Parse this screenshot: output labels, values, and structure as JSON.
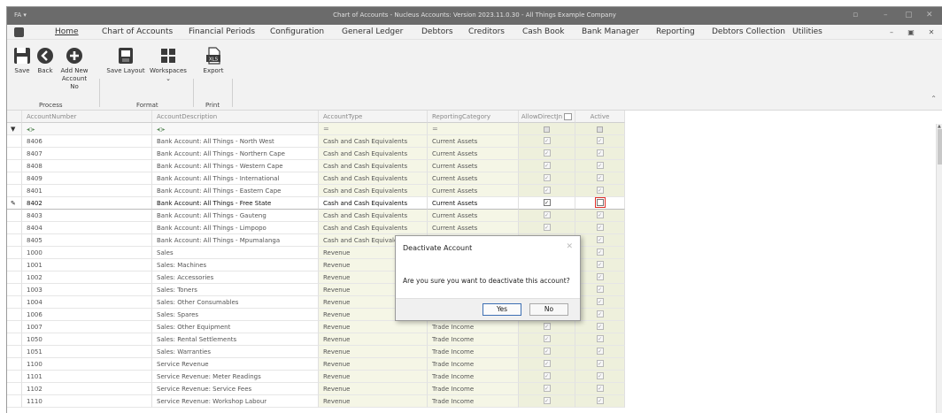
{
  "window": {
    "app_icon": "FA",
    "title": "Chart of Accounts - Nucleus Accounts: Version 2023.11.0.30 - All Things Example Company"
  },
  "menu": {
    "tabs": [
      "Home",
      "Chart of Accounts",
      "Financial Periods",
      "Configuration",
      "General Ledger",
      "Debtors",
      "Creditors",
      "Cash Book",
      "Bank Manager",
      "Reporting",
      "Debtors Collection",
      "Utilities"
    ],
    "active": "Home"
  },
  "ribbon": {
    "save": "Save",
    "back": "Back",
    "add_new_1": "Add New",
    "add_new_2": "Account No",
    "save_layout": "Save Layout",
    "workspaces": "Workspaces",
    "export": "Export",
    "export_badge": "XLS",
    "group_process": "Process",
    "group_format": "Format",
    "group_print": "Print"
  },
  "grid": {
    "headers": {
      "account_number": "AccountNumber",
      "account_description": "AccountDescription",
      "account_type": "AccountType",
      "reporting_category": "ReportingCategory",
      "allow_direct": "AllowDirectJn",
      "active": "Active"
    },
    "filter_eq": "=",
    "rows": [
      {
        "num": "8406",
        "desc": "Bank Account: All Things - North West",
        "type": "Cash and Cash Equivalents",
        "cat": "Current Assets",
        "allow": true,
        "active": true
      },
      {
        "num": "8407",
        "desc": "Bank Account: All Things - Northern Cape",
        "type": "Cash and Cash Equivalents",
        "cat": "Current Assets",
        "allow": true,
        "active": true
      },
      {
        "num": "8408",
        "desc": "Bank Account: All Things - Western Cape",
        "type": "Cash and Cash Equivalents",
        "cat": "Current Assets",
        "allow": true,
        "active": true
      },
      {
        "num": "8409",
        "desc": "Bank Account: All Things - International",
        "type": "Cash and Cash Equivalents",
        "cat": "Current Assets",
        "allow": true,
        "active": true
      },
      {
        "num": "8401",
        "desc": "Bank Account: All Things - Eastern Cape",
        "type": "Cash and Cash Equivalents",
        "cat": "Current Assets",
        "allow": true,
        "active": true
      },
      {
        "num": "8402",
        "desc": "Bank Account: All Things - Free State",
        "type": "Cash and Cash Equivalents",
        "cat": "Current Assets",
        "allow": true,
        "active": false,
        "selected": true
      },
      {
        "num": "8403",
        "desc": "Bank Account: All Things - Gauteng",
        "type": "Cash and Cash Equivalents",
        "cat": "Current Assets",
        "allow": true,
        "active": true
      },
      {
        "num": "8404",
        "desc": "Bank Account: All Things - Limpopo",
        "type": "Cash and Cash Equivalents",
        "cat": "Current Assets",
        "allow": true,
        "active": true
      },
      {
        "num": "8405",
        "desc": "Bank Account: All Things - Mpumalanga",
        "type": "Cash and Cash Equivalents",
        "cat": "",
        "allow": true,
        "active": true
      },
      {
        "num": "1000",
        "desc": "Sales",
        "type": "Revenue",
        "cat": "",
        "allow": true,
        "active": true
      },
      {
        "num": "1001",
        "desc": "Sales: Machines",
        "type": "Revenue",
        "cat": "",
        "allow": true,
        "active": true
      },
      {
        "num": "1002",
        "desc": "Sales: Accessories",
        "type": "Revenue",
        "cat": "",
        "allow": true,
        "active": true
      },
      {
        "num": "1003",
        "desc": "Sales: Toners",
        "type": "Revenue",
        "cat": "",
        "allow": true,
        "active": true
      },
      {
        "num": "1004",
        "desc": "Sales: Other Consumables",
        "type": "Revenue",
        "cat": "",
        "allow": true,
        "active": true
      },
      {
        "num": "1006",
        "desc": "Sales: Spares",
        "type": "Revenue",
        "cat": "Trade Income",
        "allow": true,
        "active": true
      },
      {
        "num": "1007",
        "desc": "Sales: Other Equipment",
        "type": "Revenue",
        "cat": "Trade Income",
        "allow": true,
        "active": true
      },
      {
        "num": "1050",
        "desc": "Sales: Rental Settlements",
        "type": "Revenue",
        "cat": "Trade Income",
        "allow": true,
        "active": true
      },
      {
        "num": "1051",
        "desc": "Sales: Warranties",
        "type": "Revenue",
        "cat": "Trade Income",
        "allow": true,
        "active": true
      },
      {
        "num": "1100",
        "desc": "Service Revenue",
        "type": "Revenue",
        "cat": "Trade Income",
        "allow": true,
        "active": true
      },
      {
        "num": "1101",
        "desc": "Service Revenue: Meter Readings",
        "type": "Revenue",
        "cat": "Trade Income",
        "allow": true,
        "active": true
      },
      {
        "num": "1102",
        "desc": "Service Revenue: Service Fees",
        "type": "Revenue",
        "cat": "Trade Income",
        "allow": true,
        "active": true
      },
      {
        "num": "1110",
        "desc": "Service Revenue: Workshop Labour",
        "type": "Revenue",
        "cat": "Trade Income",
        "allow": true,
        "active": true
      }
    ]
  },
  "dialog": {
    "title": "Deactivate Account",
    "message": "Are you sure you want to deactivate this account?",
    "yes": "Yes",
    "no": "No"
  },
  "colors": {
    "titlebar": "#6b6b6b",
    "ribbon": "#f2f2f2",
    "tint_cols": "#f5f6e6",
    "focus_outline": "#e0302a",
    "default_button": "#3d6fb3"
  }
}
